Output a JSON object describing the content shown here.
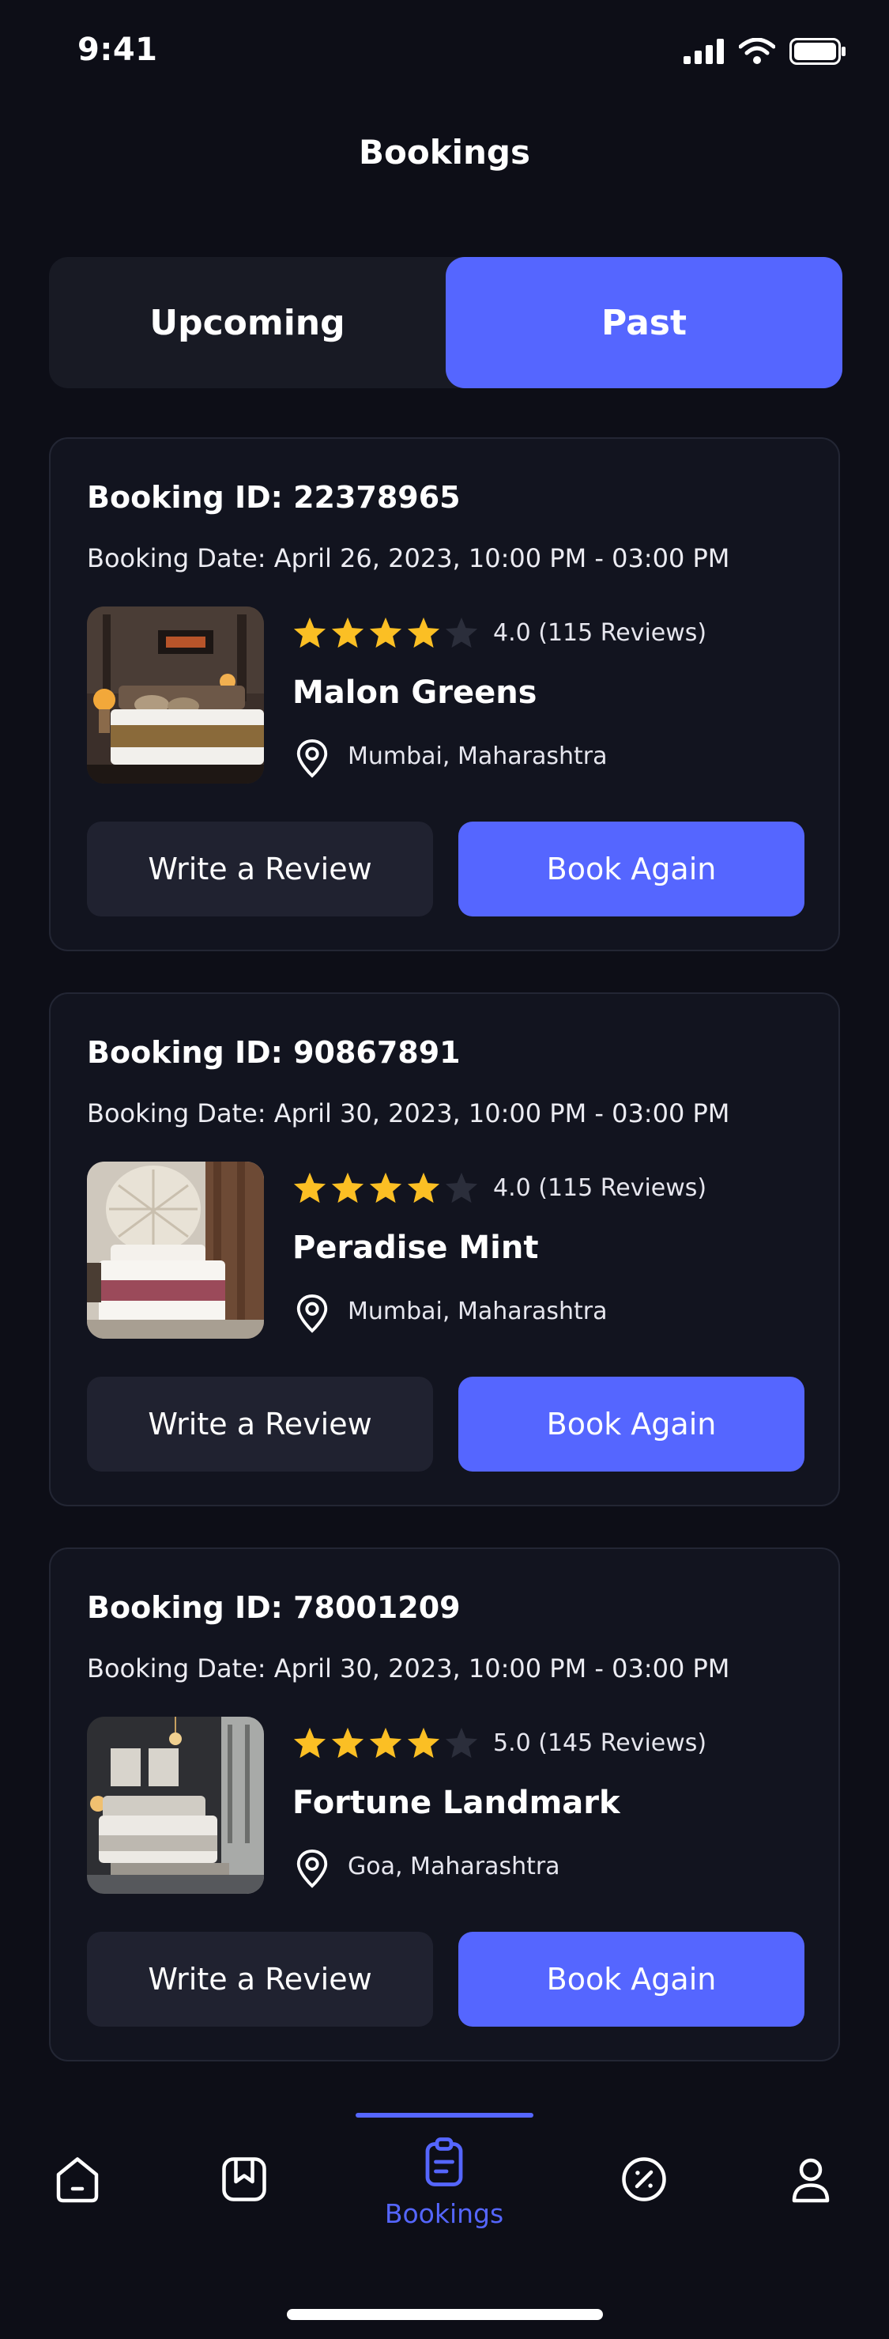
{
  "status_bar": {
    "time": "9:41"
  },
  "header": {
    "title": "Bookings"
  },
  "tabs": {
    "upcoming": "Upcoming",
    "past": "Past",
    "active": "Past"
  },
  "bookings": [
    {
      "booking_id": "Booking ID: 22378965",
      "booking_date": "Booking Date: April 26, 2023, 10:00 PM - 03:00 PM",
      "rating_text": "4.0 (115 Reviews)",
      "stars": 4,
      "hotel_name": "Malon Greens",
      "location": "Mumbai, Maharashtra",
      "review_label": "Write a Review",
      "book_again_label": "Book Again"
    },
    {
      "booking_id": "Booking ID: 90867891",
      "booking_date": "Booking Date: April 30, 2023, 10:00 PM - 03:00 PM",
      "rating_text": "4.0 (115 Reviews)",
      "stars": 4,
      "hotel_name": "Peradise Mint",
      "location": "Mumbai, Maharashtra",
      "review_label": "Write a Review",
      "book_again_label": "Book Again"
    },
    {
      "booking_id": "Booking ID: 78001209",
      "booking_date": "Booking Date: April 30, 2023, 10:00 PM - 03:00 PM",
      "rating_text": "5.0 (145 Reviews)",
      "stars": 4,
      "hotel_name": "Fortune Landmark",
      "location": "Goa, Maharashtra",
      "review_label": "Write a Review",
      "book_again_label": "Book Again"
    }
  ],
  "bottom_nav": {
    "items": [
      {
        "icon": "home-icon"
      },
      {
        "icon": "bookmark-icon"
      },
      {
        "icon": "clipboard-icon",
        "label": "Bookings",
        "active": true
      },
      {
        "icon": "discount-icon"
      },
      {
        "icon": "profile-icon"
      }
    ]
  },
  "colors": {
    "accent": "#5566ff",
    "star": "#fbbf24",
    "background": "#0d0e17",
    "card": "#12141f"
  }
}
